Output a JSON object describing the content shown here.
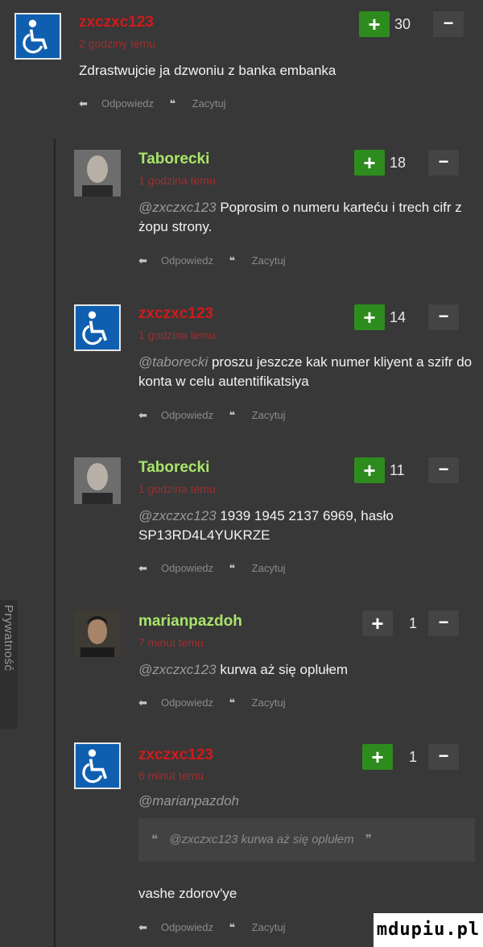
{
  "side_tab": "Prywatność",
  "action_labels": {
    "reply": "Odpowiedz",
    "quote": "Zacytuj"
  },
  "icons": {
    "reply": "reply-arrow-icon",
    "quote": "quote-icon",
    "accessibility_avatar": "wheelchair-icon"
  },
  "colors": {
    "vote_plus": "#2e8b1e",
    "username_red": "#d11a1a",
    "username_green": "#a8e56a",
    "background": "#383838"
  },
  "comments": [
    {
      "user": "zxczxc123",
      "time": "2 godziny temu",
      "votes": "30",
      "mention": "",
      "text": "Zdrastwujcie ja dzwoniu z banka embanka"
    },
    {
      "user": "Taborecki",
      "time": "1 godzina temu",
      "votes": "18",
      "mention": "@zxczxc123",
      "text": " Poprosim o numeru karteću i trech cifr z żopu strony."
    },
    {
      "user": "zxczxc123",
      "time": "1 godzina temu",
      "votes": "14",
      "mention": "@taborecki",
      "text": " proszu jeszcze kak numer kliyent a szifr do konta w celu autentifikatsiya"
    },
    {
      "user": "Taborecki",
      "time": "1 godzina temu",
      "votes": "11",
      "mention": "@zxczxc123",
      "text": " 1939 1945 2137 6969, hasło SP13RD4L4YUKRZE"
    },
    {
      "user": "marianpazdoh",
      "time": "7 minut temu",
      "votes": "1",
      "mention": "@zxczxc123",
      "text": " kurwa aż się oplułem"
    },
    {
      "user": "zxczxc123",
      "time": "6 minut temu",
      "votes": "1",
      "mention": "@marianpazdoh",
      "quote": "@zxczxc123 kurwa aż się oplułem",
      "text": "vashe zdorov'ye"
    }
  ],
  "watermark": "mdupiu.pl"
}
